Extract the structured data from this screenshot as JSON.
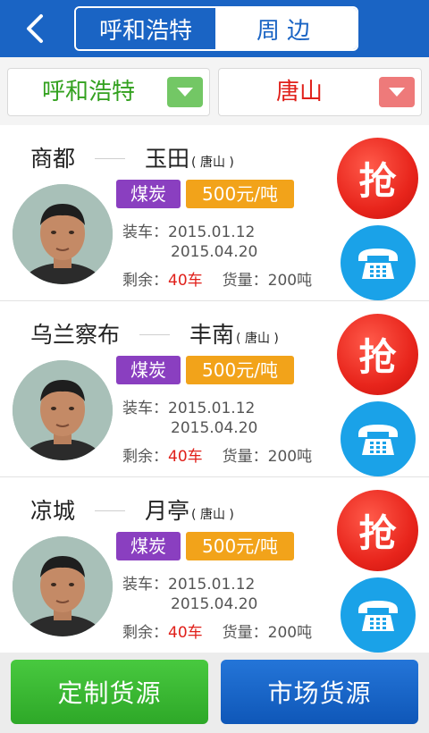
{
  "header": {
    "back_icon": "chevron-left-icon",
    "tabs": [
      {
        "label": "呼和浩特",
        "active": true
      },
      {
        "label": "周边",
        "active": false
      }
    ]
  },
  "filter": {
    "origin": "呼和浩特",
    "destination": "唐山",
    "origin_color": "#33a11f",
    "destination_color": "#e0201a"
  },
  "listings": [
    {
      "from": "商都",
      "to": "玉田",
      "to_sub": "( 唐山 )",
      "cargo": "煤炭",
      "price": "500元/吨",
      "load_label": "装车：",
      "load_start": "2015.01.12",
      "load_end": "2015.04.20",
      "remain_label": "剩余：",
      "remain_value": "40车",
      "volume_label": "货量：",
      "volume_value": "200吨",
      "grab_label": "抢"
    },
    {
      "from": "乌兰察布",
      "to": "丰南",
      "to_sub": "( 唐山 )",
      "cargo": "煤炭",
      "price": "500元/吨",
      "load_label": "装车：",
      "load_start": "2015.01.12",
      "load_end": "2015.04.20",
      "remain_label": "剩余：",
      "remain_value": "40车",
      "volume_label": "货量：",
      "volume_value": "200吨",
      "grab_label": "抢"
    },
    {
      "from": "凉城",
      "to": "月亭",
      "to_sub": "( 唐山 )",
      "cargo": "煤炭",
      "price": "500元/吨",
      "load_label": "装车：",
      "load_start": "2015.01.12",
      "load_end": "2015.04.20",
      "remain_label": "剩余：",
      "remain_value": "40车",
      "volume_label": "货量：",
      "volume_value": "200吨",
      "grab_label": "抢"
    }
  ],
  "bottom": {
    "custom_label": "定制货源",
    "market_label": "市场货源"
  },
  "colors": {
    "primary": "#1a64c4",
    "cargo_tag": "#8a3fc0",
    "price_tag": "#f2a31a",
    "grab": "#e8251c",
    "call": "#1aa2e8",
    "custom_button": "#3bb832"
  }
}
